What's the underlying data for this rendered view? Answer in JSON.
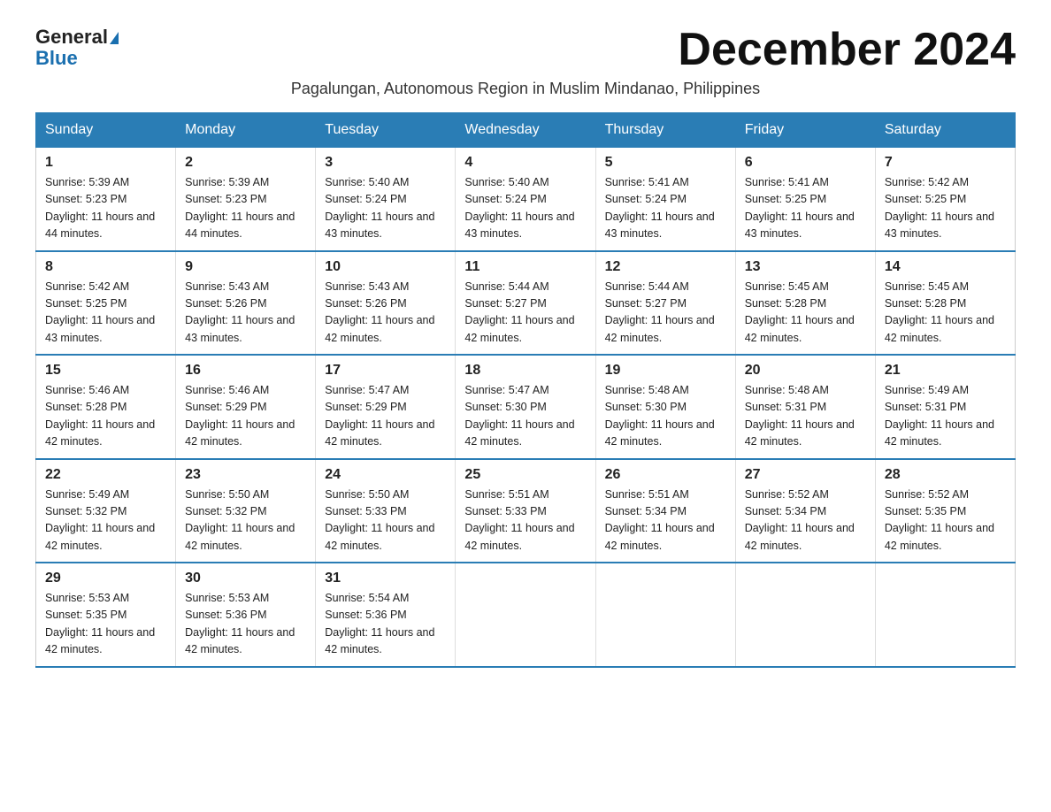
{
  "logo": {
    "general": "General",
    "blue": "Blue"
  },
  "title": "December 2024",
  "subtitle": "Pagalungan, Autonomous Region in Muslim Mindanao, Philippines",
  "days_of_week": [
    "Sunday",
    "Monday",
    "Tuesday",
    "Wednesday",
    "Thursday",
    "Friday",
    "Saturday"
  ],
  "weeks": [
    [
      {
        "day": "1",
        "sunrise": "5:39 AM",
        "sunset": "5:23 PM",
        "daylight": "11 hours and 44 minutes."
      },
      {
        "day": "2",
        "sunrise": "5:39 AM",
        "sunset": "5:23 PM",
        "daylight": "11 hours and 44 minutes."
      },
      {
        "day": "3",
        "sunrise": "5:40 AM",
        "sunset": "5:24 PM",
        "daylight": "11 hours and 43 minutes."
      },
      {
        "day": "4",
        "sunrise": "5:40 AM",
        "sunset": "5:24 PM",
        "daylight": "11 hours and 43 minutes."
      },
      {
        "day": "5",
        "sunrise": "5:41 AM",
        "sunset": "5:24 PM",
        "daylight": "11 hours and 43 minutes."
      },
      {
        "day": "6",
        "sunrise": "5:41 AM",
        "sunset": "5:25 PM",
        "daylight": "11 hours and 43 minutes."
      },
      {
        "day": "7",
        "sunrise": "5:42 AM",
        "sunset": "5:25 PM",
        "daylight": "11 hours and 43 minutes."
      }
    ],
    [
      {
        "day": "8",
        "sunrise": "5:42 AM",
        "sunset": "5:25 PM",
        "daylight": "11 hours and 43 minutes."
      },
      {
        "day": "9",
        "sunrise": "5:43 AM",
        "sunset": "5:26 PM",
        "daylight": "11 hours and 43 minutes."
      },
      {
        "day": "10",
        "sunrise": "5:43 AM",
        "sunset": "5:26 PM",
        "daylight": "11 hours and 42 minutes."
      },
      {
        "day": "11",
        "sunrise": "5:44 AM",
        "sunset": "5:27 PM",
        "daylight": "11 hours and 42 minutes."
      },
      {
        "day": "12",
        "sunrise": "5:44 AM",
        "sunset": "5:27 PM",
        "daylight": "11 hours and 42 minutes."
      },
      {
        "day": "13",
        "sunrise": "5:45 AM",
        "sunset": "5:28 PM",
        "daylight": "11 hours and 42 minutes."
      },
      {
        "day": "14",
        "sunrise": "5:45 AM",
        "sunset": "5:28 PM",
        "daylight": "11 hours and 42 minutes."
      }
    ],
    [
      {
        "day": "15",
        "sunrise": "5:46 AM",
        "sunset": "5:28 PM",
        "daylight": "11 hours and 42 minutes."
      },
      {
        "day": "16",
        "sunrise": "5:46 AM",
        "sunset": "5:29 PM",
        "daylight": "11 hours and 42 minutes."
      },
      {
        "day": "17",
        "sunrise": "5:47 AM",
        "sunset": "5:29 PM",
        "daylight": "11 hours and 42 minutes."
      },
      {
        "day": "18",
        "sunrise": "5:47 AM",
        "sunset": "5:30 PM",
        "daylight": "11 hours and 42 minutes."
      },
      {
        "day": "19",
        "sunrise": "5:48 AM",
        "sunset": "5:30 PM",
        "daylight": "11 hours and 42 minutes."
      },
      {
        "day": "20",
        "sunrise": "5:48 AM",
        "sunset": "5:31 PM",
        "daylight": "11 hours and 42 minutes."
      },
      {
        "day": "21",
        "sunrise": "5:49 AM",
        "sunset": "5:31 PM",
        "daylight": "11 hours and 42 minutes."
      }
    ],
    [
      {
        "day": "22",
        "sunrise": "5:49 AM",
        "sunset": "5:32 PM",
        "daylight": "11 hours and 42 minutes."
      },
      {
        "day": "23",
        "sunrise": "5:50 AM",
        "sunset": "5:32 PM",
        "daylight": "11 hours and 42 minutes."
      },
      {
        "day": "24",
        "sunrise": "5:50 AM",
        "sunset": "5:33 PM",
        "daylight": "11 hours and 42 minutes."
      },
      {
        "day": "25",
        "sunrise": "5:51 AM",
        "sunset": "5:33 PM",
        "daylight": "11 hours and 42 minutes."
      },
      {
        "day": "26",
        "sunrise": "5:51 AM",
        "sunset": "5:34 PM",
        "daylight": "11 hours and 42 minutes."
      },
      {
        "day": "27",
        "sunrise": "5:52 AM",
        "sunset": "5:34 PM",
        "daylight": "11 hours and 42 minutes."
      },
      {
        "day": "28",
        "sunrise": "5:52 AM",
        "sunset": "5:35 PM",
        "daylight": "11 hours and 42 minutes."
      }
    ],
    [
      {
        "day": "29",
        "sunrise": "5:53 AM",
        "sunset": "5:35 PM",
        "daylight": "11 hours and 42 minutes."
      },
      {
        "day": "30",
        "sunrise": "5:53 AM",
        "sunset": "5:36 PM",
        "daylight": "11 hours and 42 minutes."
      },
      {
        "day": "31",
        "sunrise": "5:54 AM",
        "sunset": "5:36 PM",
        "daylight": "11 hours and 42 minutes."
      },
      null,
      null,
      null,
      null
    ]
  ]
}
